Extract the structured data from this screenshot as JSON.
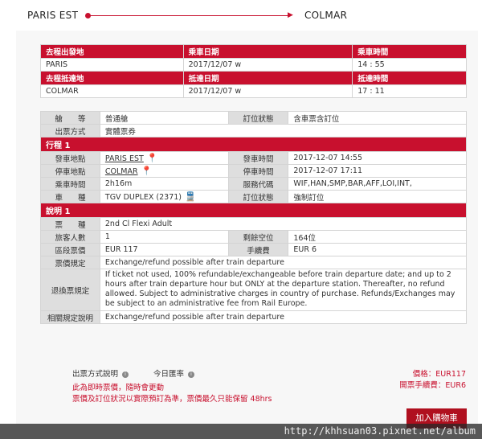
{
  "route": {
    "from": "PARIS EST",
    "to": "COLMAR"
  },
  "top_table": {
    "row1_headers": [
      "去程出發地",
      "乘車日期",
      "乘車時間"
    ],
    "row1_values": [
      "PARIS",
      "2017/12/07 w",
      "14 : 55"
    ],
    "row2_headers": [
      "去程抵達地",
      "抵達日期",
      "抵達時間"
    ],
    "row2_values": [
      "COLMAR",
      "2017/12/07 w",
      "17 : 11"
    ]
  },
  "class_row": {
    "label": "艙　　等",
    "value": "普通艙",
    "label2": "訂位狀態",
    "value2": "含車票含訂位"
  },
  "ticket_row": {
    "label": "出票方式",
    "value": "實體票券"
  },
  "itinerary": {
    "title": "行程 1",
    "depart_station_label": "發車地點",
    "depart_station": "PARIS EST",
    "depart_time_label": "發車時間",
    "depart_time": "2017-12-07 14:55",
    "arrive_station_label": "停車地點",
    "arrive_station": "COLMAR",
    "arrive_time_label": "停車時間",
    "arrive_time": "2017-12-07 17:11",
    "duration_label": "乘車時間",
    "duration": "2h16m",
    "service_label": "服務代碼",
    "service": "WIF,HAN,SMP,BAR,AFF,LOI,INT,",
    "train_label": "車　　種",
    "train": "TGV DUPLEX (2371)",
    "booking_label": "訂位狀態",
    "booking": "強制訂位"
  },
  "notes": {
    "title": "說明 1",
    "fare_label": "票　　種",
    "fare": "2nd Cl Flexi Adult",
    "pax_label": "旅客人數",
    "pax": "1",
    "seats_label": "剩餘空位",
    "seats": "164位",
    "price_label": "區段票價",
    "price": "EUR 117",
    "fee_label": "手續費",
    "fee": "EUR 6",
    "rule_label": "票價規定",
    "rule": "Exchange/refund possible after train departure",
    "refund_label": "退換票規定",
    "refund": "If ticket not used, 100% refundable/exchangeable before train departure date; and up to 2 hours after train departure hour but ONLY at the departure station. Thereafter, no refund allowed. Subject to administrative charges in country of purchase. Refunds/Exchanges may be subject to an administrative fee from Rail Europe.",
    "related_label": "相關規定說明",
    "related": "Exchange/refund possible after train departure"
  },
  "footer": {
    "issue_info": "出票方式說明",
    "rate_info": "今日匯率",
    "warn1": "此為即時票價，隨時會更動",
    "warn2": "票價及訂位狀況以實際預訂為準，票價最久只能保留 48hrs",
    "price": "價格：EUR117",
    "fee": "開票手續費：EUR6",
    "add_cart": "加入購物車"
  },
  "watermark": "http://khhsuan03.pixnet.net/album",
  "colors": {
    "accent": "#c8102e",
    "label_bg": "#dedede"
  }
}
